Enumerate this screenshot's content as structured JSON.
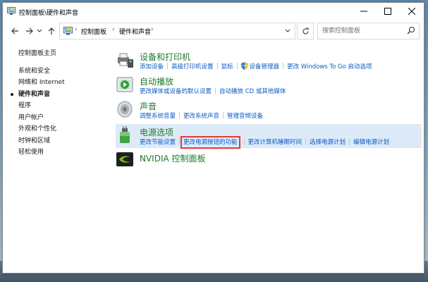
{
  "window": {
    "title": "控制面板\\硬件和声音"
  },
  "address": {
    "crumbs": [
      "控制面板",
      "硬件和声音"
    ],
    "search_placeholder": "搜索控制面板"
  },
  "sidebar": {
    "items": [
      {
        "label": "控制面板主页"
      },
      {
        "label": "系统和安全"
      },
      {
        "label": "网络和 Internet"
      },
      {
        "label": "硬件和声音"
      },
      {
        "label": "程序"
      },
      {
        "label": "用户帐户"
      },
      {
        "label": "外观和个性化"
      },
      {
        "label": "时钟和区域"
      },
      {
        "label": "轻松使用"
      }
    ]
  },
  "categories": [
    {
      "title": "设备和打印机",
      "icon": "printer-icon",
      "links": [
        "添加设备",
        "高级打印机设置",
        "鼠标",
        "设备管理器",
        "更改 Windows To Go 启动选项"
      ]
    },
    {
      "title": "自动播放",
      "icon": "autoplay-icon",
      "links": [
        "更改媒体或设备的默认设置",
        "自动播放 CD 或其他媒体"
      ]
    },
    {
      "title": "声音",
      "icon": "speaker-icon",
      "links": [
        "调整系统音量",
        "更改系统声音",
        "管理音频设备"
      ]
    },
    {
      "title": "电源选项",
      "icon": "power-icon",
      "links": [
        "更改节能设置",
        "更改电源按钮的功能",
        "更改计算机睡眠时间",
        "选择电源计划",
        "编辑电源计划"
      ]
    },
    {
      "title": "NVIDIA 控制面板",
      "icon": "nvidia-icon",
      "links": []
    }
  ],
  "colors": {
    "link": "#0b5bc5",
    "category_title": "#1e7a2a",
    "highlight_box": "#e53935",
    "hover_row": "#ddeaf7"
  }
}
